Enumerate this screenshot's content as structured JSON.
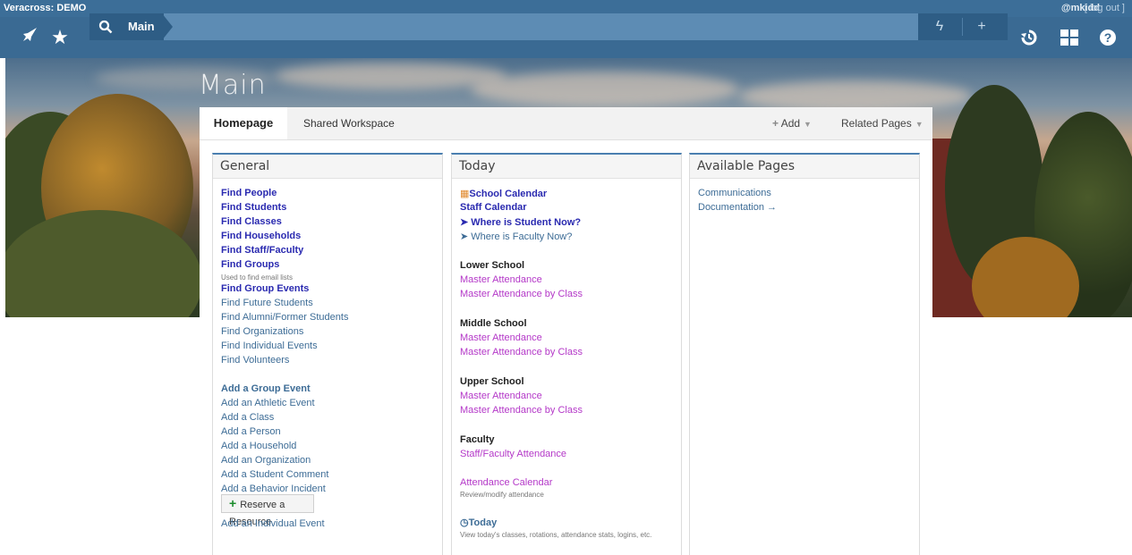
{
  "topbar": {
    "app": "Veracross: DEMO",
    "user": "@mkidd",
    "logout": "[ log out ]"
  },
  "nav": {
    "crumb": "Main"
  },
  "icons": {
    "rocket": "✈",
    "star": "★",
    "search": "⚲",
    "bolt": "ϟ",
    "plus": "+",
    "history": "↺",
    "grid": "▦",
    "help": "?"
  },
  "banner": {
    "title": "Main"
  },
  "tabs": {
    "homepage": "Homepage",
    "shared": "Shared Workspace",
    "add": "Add",
    "related": "Related Pages"
  },
  "general": {
    "title": "General",
    "links": [
      "Find People",
      "Find Students",
      "Find Classes",
      "Find Households",
      "Find Staff/Faculty",
      "Find Groups",
      "Used to find email lists",
      "Find Group Events",
      "Find Future Students",
      "Find Alumni/Former Students",
      "Find Organizations",
      "Find Individual Events",
      "Find Volunteers",
      "Add a Group Event",
      "Add an Athletic Event",
      "Add a Class",
      "Add a Person",
      "Add a Household",
      "Add an Organization",
      "Add a Student Comment",
      "Add a Behavior Incident"
    ],
    "reserve": "Reserve a Resource",
    "individual_event": "Add an Individual Event"
  },
  "today": {
    "title": "Today",
    "school_calendar": "School Calendar",
    "staff_calendar": "Staff Calendar",
    "where_student": "Where is Student Now?",
    "where_faculty": "Where is Faculty Now?",
    "lower": "Lower School",
    "middle": "Middle School",
    "upper": "Upper School",
    "faculty": "Faculty",
    "master_attendance": "Master Attendance",
    "master_by_class": "Master Attendance by Class",
    "staff_attendance": "Staff/Faculty Attendance",
    "attendance_calendar": "Attendance Calendar",
    "review": "Review/modify attendance",
    "today_link": "Today",
    "today_desc": "View today's classes, rotations, attendance stats, logins, etc."
  },
  "available": {
    "title": "Available Pages",
    "communications": "Communications",
    "documentation": "Documentation →"
  }
}
